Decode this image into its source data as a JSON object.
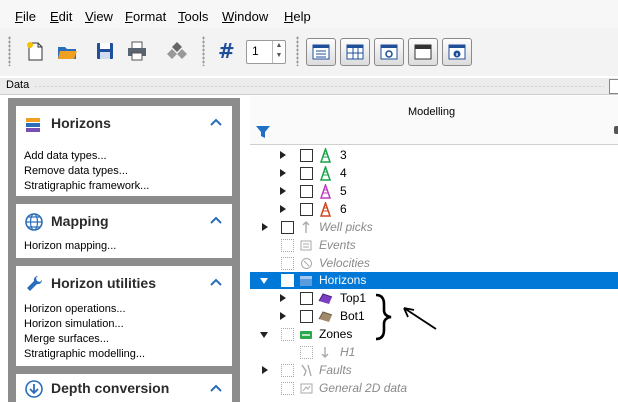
{
  "menu": [
    "File",
    "Edit",
    "View",
    "Format",
    "Tools",
    "Window",
    "Help"
  ],
  "toolbar": {
    "spin_value": "1"
  },
  "data_panel": {
    "title": "Data"
  },
  "left": {
    "cards": [
      {
        "title": "Horizons",
        "items": [
          "Add data types...",
          "Remove data types...",
          "Stratigraphic framework..."
        ]
      },
      {
        "title": "Mapping",
        "items": [
          "Horizon mapping..."
        ]
      },
      {
        "title": "Horizon utilities",
        "items": [
          "Horizon operations...",
          "Horizon simulation...",
          "Merge surfaces...",
          "Stratigraphic modelling..."
        ]
      },
      {
        "title": "Depth conversion",
        "items": []
      }
    ]
  },
  "tree": {
    "header": "Modelling",
    "rows": [
      {
        "label": "3"
      },
      {
        "label": "4"
      },
      {
        "label": "5"
      },
      {
        "label": "6"
      },
      {
        "label": "Well picks"
      },
      {
        "label": "Events"
      },
      {
        "label": "Velocities"
      },
      {
        "label": "Horizons"
      },
      {
        "label": "Top1"
      },
      {
        "label": "Bot1"
      },
      {
        "label": "Zones"
      },
      {
        "label": "H1"
      },
      {
        "label": "Faults"
      },
      {
        "label": "General 2D data"
      }
    ]
  },
  "colors": {
    "selection": "#0078d7",
    "panel_gray": "#8c8c8c",
    "accent_blue": "#2a6ebb"
  }
}
